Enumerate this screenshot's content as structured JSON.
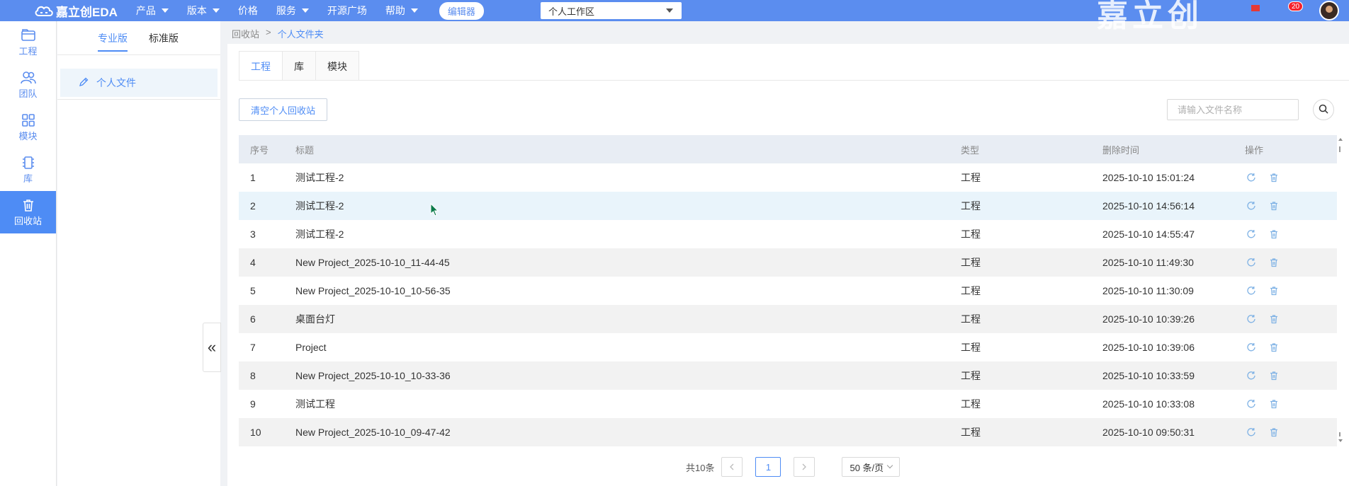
{
  "topbar": {
    "logo_text": "嘉立创EDA",
    "nav": [
      {
        "label": "产品",
        "has_caret": true
      },
      {
        "label": "版本",
        "has_caret": true
      },
      {
        "label": "价格",
        "has_caret": false
      },
      {
        "label": "服务",
        "has_caret": true
      },
      {
        "label": "开源广场",
        "has_caret": false
      },
      {
        "label": "帮助",
        "has_caret": true
      }
    ],
    "editor_button": "编辑器",
    "workspace_select": "个人工作区",
    "brand_watermark": "嘉立创",
    "notification_count": "20"
  },
  "rail": {
    "items": [
      {
        "label": "工程",
        "icon": "folder-icon",
        "active": false
      },
      {
        "label": "团队",
        "icon": "team-icon",
        "active": false
      },
      {
        "label": "模块",
        "icon": "module-icon",
        "active": false
      },
      {
        "label": "库",
        "icon": "library-icon",
        "active": false
      },
      {
        "label": "回收站",
        "icon": "trash-icon",
        "active": true
      }
    ]
  },
  "panel": {
    "tabs": [
      {
        "label": "专业版",
        "active": true
      },
      {
        "label": "标准版",
        "active": false
      }
    ],
    "folder": "个人文件",
    "collapse_glyph": "«"
  },
  "breadcrumb": {
    "root": "回收站",
    "separator": ">",
    "current": "个人文件夹"
  },
  "main": {
    "tabs": [
      {
        "label": "工程",
        "active": true
      },
      {
        "label": "库",
        "active": false
      },
      {
        "label": "模块",
        "active": false
      }
    ],
    "clear_button": "清空个人回收站",
    "search_placeholder": "请输入文件名称"
  },
  "table": {
    "columns": {
      "index": "序号",
      "title": "标题",
      "type": "类型",
      "deleted_time": "删除时间",
      "actions": "操作"
    },
    "rows": [
      {
        "index": "1",
        "title": "测试工程-2",
        "type": "工程",
        "deleted_time": "2025-10-10 15:01:24"
      },
      {
        "index": "2",
        "title": "测试工程-2",
        "type": "工程",
        "deleted_time": "2025-10-10 14:56:14"
      },
      {
        "index": "3",
        "title": "测试工程-2",
        "type": "工程",
        "deleted_time": "2025-10-10 14:55:47"
      },
      {
        "index": "4",
        "title": "New Project_2025-10-10_11-44-45",
        "type": "工程",
        "deleted_time": "2025-10-10 11:49:30"
      },
      {
        "index": "5",
        "title": "New Project_2025-10-10_10-56-35",
        "type": "工程",
        "deleted_time": "2025-10-10 11:30:09"
      },
      {
        "index": "6",
        "title": "桌面台灯",
        "type": "工程",
        "deleted_time": "2025-10-10 10:39:26"
      },
      {
        "index": "7",
        "title": "Project",
        "type": "工程",
        "deleted_time": "2025-10-10 10:39:06"
      },
      {
        "index": "8",
        "title": "New Project_2025-10-10_10-33-36",
        "type": "工程",
        "deleted_time": "2025-10-10 10:33:59"
      },
      {
        "index": "9",
        "title": "测试工程",
        "type": "工程",
        "deleted_time": "2025-10-10 10:33:08"
      },
      {
        "index": "10",
        "title": "New Project_2025-10-10_09-47-42",
        "type": "工程",
        "deleted_time": "2025-10-10 09:50:31"
      }
    ],
    "row_action_icons": [
      "restore-icon",
      "delete-icon"
    ]
  },
  "pagination": {
    "total": "共10条",
    "current_page": "1",
    "page_size": "50 条/页"
  },
  "colors": {
    "topbar": "#5b8def",
    "accent": "#4e8cf5",
    "rail_active": "#4e8cf5",
    "row_stripe": "#f2f2f2",
    "row_hover": "#e9f4fb"
  }
}
